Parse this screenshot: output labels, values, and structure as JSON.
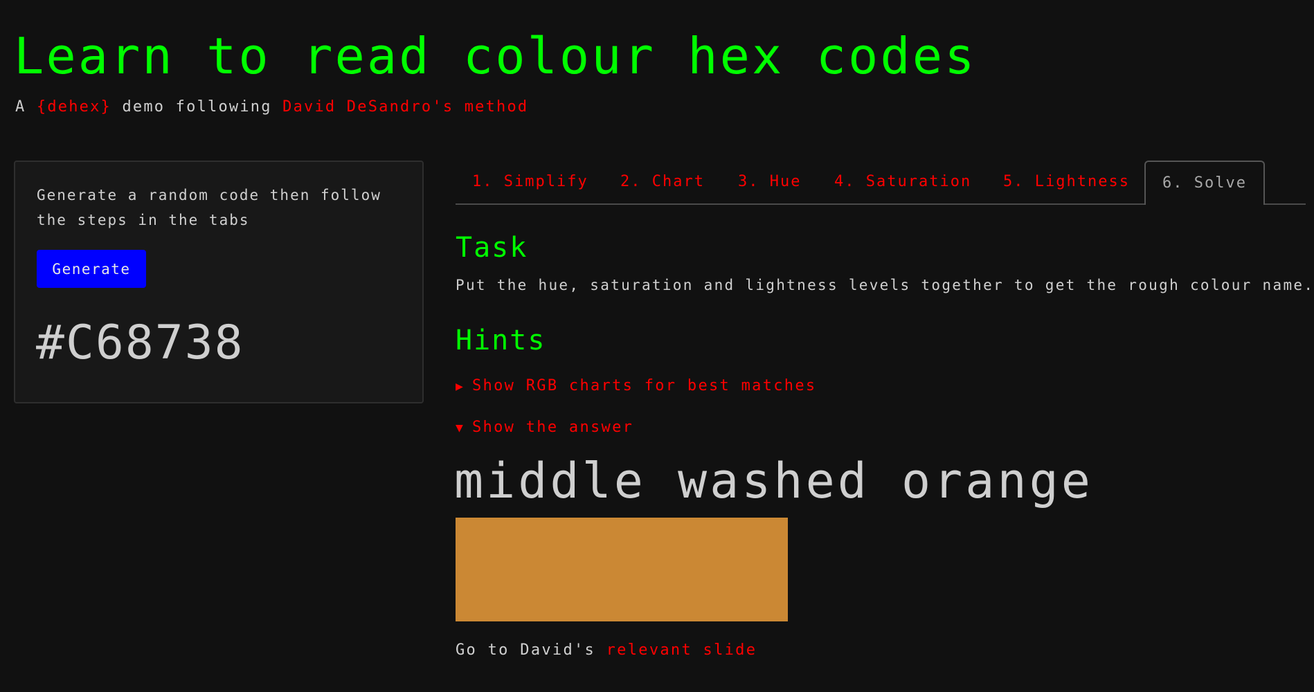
{
  "header": {
    "title": "Learn to read colour hex codes",
    "subtitle_prefix": "A ",
    "package_link": "{dehex}",
    "subtitle_middle": " demo following ",
    "method_link": "David DeSandro's method"
  },
  "sidebar": {
    "instructions": "Generate a random code then follow the steps in the tabs",
    "generate_label": "Generate",
    "hex_code": "#C68738"
  },
  "tabs": [
    {
      "label": "1. Simplify",
      "active": false
    },
    {
      "label": "2. Chart",
      "active": false
    },
    {
      "label": "3. Hue",
      "active": false
    },
    {
      "label": "4. Saturation",
      "active": false
    },
    {
      "label": "5. Lightness",
      "active": false
    },
    {
      "label": "6. Solve",
      "active": true
    }
  ],
  "main": {
    "task_heading": "Task",
    "task_text": "Put the hue, saturation and lightness levels together to get the rough colour name.",
    "hints_heading": "Hints",
    "hint_rgb": {
      "label": "Show RGB charts for best matches",
      "expanded": false,
      "icon": "triangle-right"
    },
    "hint_answer": {
      "label": "Show the answer",
      "expanded": true,
      "icon": "triangle-down"
    },
    "answer_text": "middle washed orange",
    "answer_swatch_color": "#CB8834",
    "slide_prefix": "Go to David's ",
    "slide_link": "relevant slide"
  },
  "colors": {
    "background": "#111111",
    "heading": "#00FF00",
    "link": "#FF0000",
    "button": "#0000FF"
  }
}
